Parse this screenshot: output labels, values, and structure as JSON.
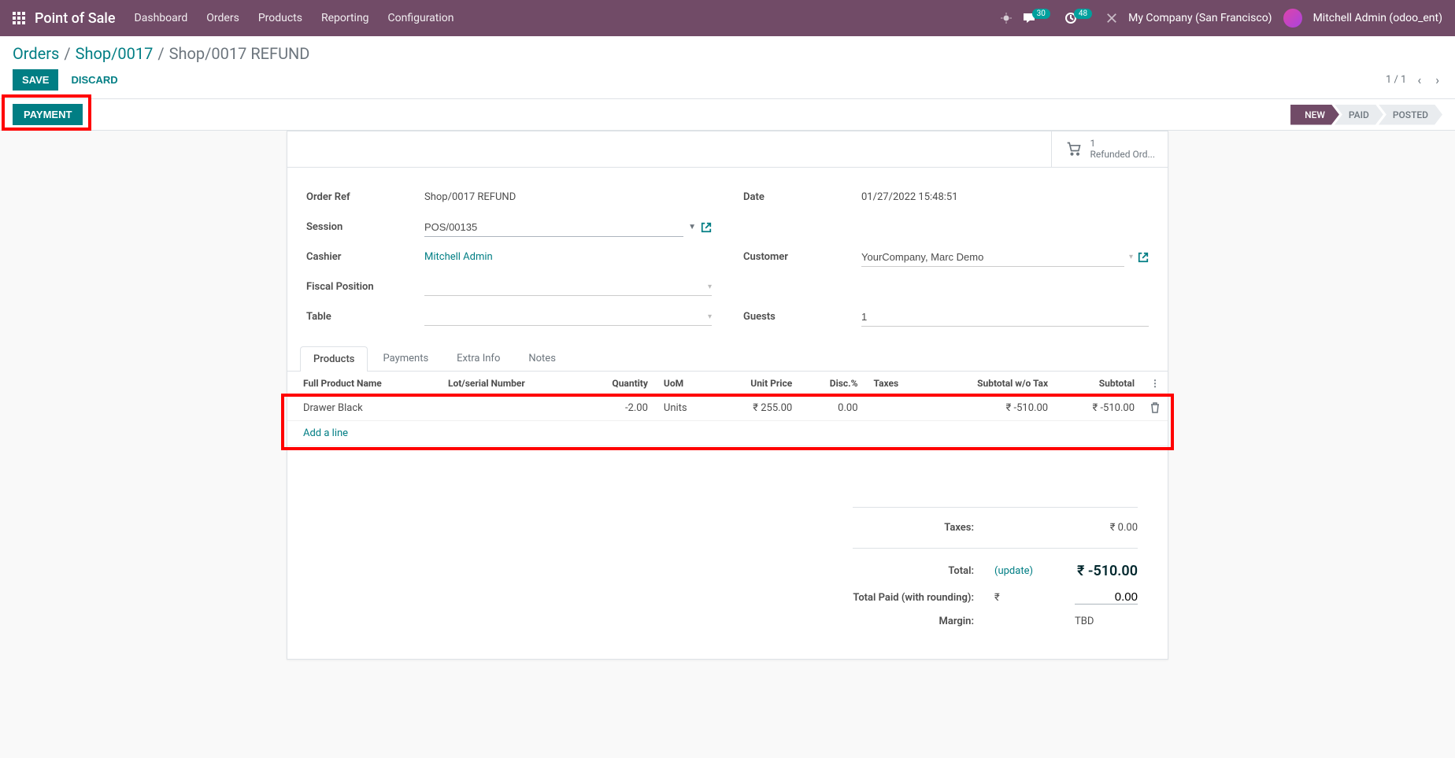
{
  "navbar": {
    "brand": "Point of Sale",
    "links": [
      "Dashboard",
      "Orders",
      "Products",
      "Reporting",
      "Configuration"
    ],
    "messages_badge": "30",
    "activities_badge": "48",
    "company": "My Company (San Francisco)",
    "user": "Mitchell Admin (odoo_ent)"
  },
  "breadcrumb": {
    "root": "Orders",
    "parent": "Shop/0017",
    "current": "Shop/0017 REFUND"
  },
  "control": {
    "save": "SAVE",
    "discard": "DISCARD",
    "pager": "1 / 1"
  },
  "statusbar": {
    "payment": "PAYMENT",
    "steps": [
      "NEW",
      "PAID",
      "POSTED"
    ],
    "active_step": 0
  },
  "stat_button": {
    "count": "1",
    "label": "Refunded Ord..."
  },
  "fields": {
    "order_ref_label": "Order Ref",
    "order_ref_value": "Shop/0017 REFUND",
    "session_label": "Session",
    "session_value": "POS/00135",
    "cashier_label": "Cashier",
    "cashier_value": "Mitchell Admin",
    "fiscal_label": "Fiscal Position",
    "table_label": "Table",
    "date_label": "Date",
    "date_value": "01/27/2022 15:48:51",
    "customer_label": "Customer",
    "customer_value": "YourCompany, Marc Demo",
    "guests_label": "Guests",
    "guests_value": "1"
  },
  "tabs": [
    "Products",
    "Payments",
    "Extra Info",
    "Notes"
  ],
  "table": {
    "headers": {
      "name": "Full Product Name",
      "lot": "Lot/serial Number",
      "qty": "Quantity",
      "uom": "UoM",
      "unit_price": "Unit Price",
      "disc": "Disc.%",
      "taxes": "Taxes",
      "subtotal_wo": "Subtotal w/o Tax",
      "subtotal": "Subtotal"
    },
    "rows": [
      {
        "name": "Drawer Black",
        "lot": "",
        "qty": "-2.00",
        "uom": "Units",
        "unit_price": "₹ 255.00",
        "disc": "0.00",
        "taxes": "",
        "subtotal_wo": "₹ -510.00",
        "subtotal": "₹ -510.00"
      }
    ],
    "add_line": "Add a line"
  },
  "totals": {
    "taxes_label": "Taxes:",
    "taxes_value": "₹ 0.00",
    "total_label": "Total:",
    "update": "(update)",
    "total_value": "₹ -510.00",
    "paid_label": "Total Paid (with rounding):",
    "paid_currency": "₹",
    "paid_value": "0.00",
    "margin_label": "Margin:",
    "margin_value": "TBD"
  }
}
